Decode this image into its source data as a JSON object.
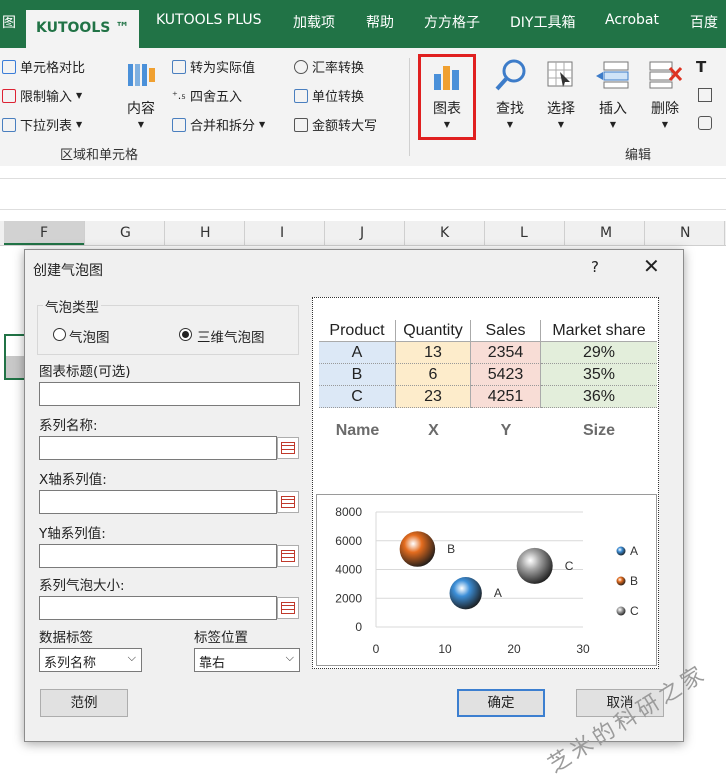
{
  "ribbon": {
    "tabs": [
      "图",
      "KUTOOLS ™",
      "KUTOOLS PLUS",
      "加载项",
      "帮助",
      "方方格子",
      "DIY工具箱",
      "Acrobat",
      "百度"
    ],
    "left_items": [
      "单元格对比",
      "限制输入",
      "下拉列表"
    ],
    "content_button": "内容",
    "mid_items": [
      "转为实际值",
      "四舍五入",
      "合并和拆分"
    ],
    "right_items": [
      "汇率转换",
      "单位转换",
      "金额转大写"
    ],
    "group_label_range": "区域和单元格",
    "chart_button": "图表",
    "find_button": "查找",
    "select_button": "选择",
    "insert_button": "插入",
    "delete_button": "删除",
    "group_label_edit": "编辑",
    "highlight_color": "#e02020",
    "accent": "#217346"
  },
  "sheet": {
    "columns": [
      "F",
      "G",
      "H",
      "I",
      "J",
      "K",
      "L",
      "M",
      "N"
    ]
  },
  "dialog": {
    "title": "创建气泡图",
    "help": "?",
    "close": "✕",
    "bubble_type_label": "气泡类型",
    "radio_2d": "气泡图",
    "radio_3d": "三维气泡图",
    "selected_type": "三维气泡图",
    "chart_title_label": "图表标题(可选)",
    "series_name_label": "系列名称:",
    "x_values_label": "X轴系列值:",
    "y_values_label": "Y轴系列值:",
    "bubble_size_label": "系列气泡大小:",
    "data_label_label": "数据标签",
    "data_label_value": "系列名称",
    "label_position_label": "标签位置",
    "label_position_value": "靠右",
    "example_button": "范例",
    "ok_button": "确定",
    "cancel_button": "取消"
  },
  "preview_table": {
    "headers": [
      "Product",
      "Quantity",
      "Sales",
      "Market share"
    ],
    "rows": [
      [
        "A",
        "13",
        "2354",
        "29%"
      ],
      [
        "B",
        "6",
        "5423",
        "35%"
      ],
      [
        "C",
        "23",
        "4251",
        "36%"
      ]
    ],
    "footer": [
      "Name",
      "X",
      "Y",
      "Size"
    ]
  },
  "chart_data": {
    "type": "scatter",
    "subtype": "bubble-3d",
    "title": "",
    "xlabel": "",
    "ylabel": "",
    "xlim": [
      0,
      30
    ],
    "ylim": [
      0,
      8000
    ],
    "xticks": [
      "0",
      "10",
      "20",
      "30"
    ],
    "yticks": [
      "0",
      "2000",
      "4000",
      "6000",
      "8000"
    ],
    "grid": true,
    "legend_position": "right",
    "series": [
      {
        "name": "A",
        "x": 13,
        "y": 2354,
        "size": 29,
        "color": "#3d8fd8"
      },
      {
        "name": "B",
        "x": 6,
        "y": 5423,
        "size": 35,
        "color": "#e46c1e"
      },
      {
        "name": "C",
        "x": 23,
        "y": 4251,
        "size": 36,
        "color": "#a8a8a8"
      }
    ]
  },
  "watermark": "芝米的科研之家"
}
